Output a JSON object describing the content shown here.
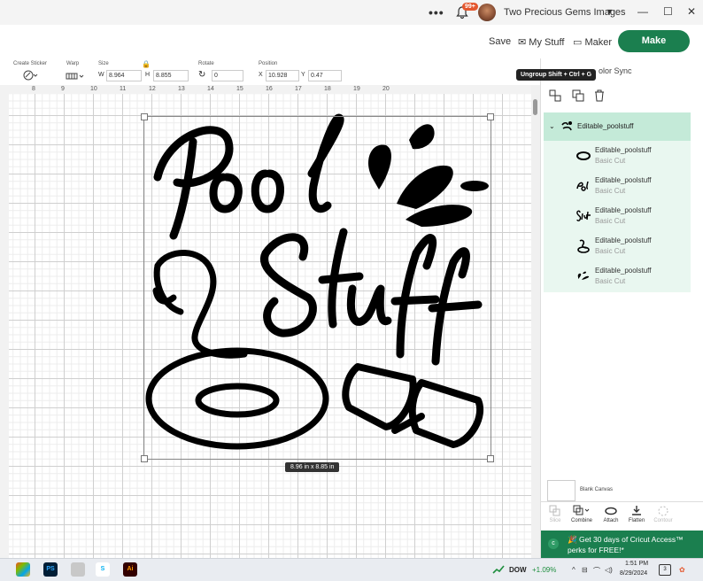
{
  "titlebar": {
    "more_label": "•••",
    "notification_badge": "99+",
    "account_name": "Two Precious Gems Images"
  },
  "header": {
    "save_label": "Save",
    "my_stuff_label": "My Stuff",
    "machine_label": "Maker",
    "make_button_label": "Make"
  },
  "toolbar": {
    "create_sticker_label": "Create Sticker",
    "warp_label": "Warp",
    "size_label": "Size",
    "width_prefix": "W",
    "width_value": "8.964",
    "height_prefix": "H",
    "height_value": "8.855",
    "rotate_label": "Rotate",
    "rotate_value": "0",
    "position_label": "Position",
    "x_prefix": "X",
    "x_value": "10.928",
    "y_prefix": "Y",
    "y_value": "0.47"
  },
  "ruler": {
    "ticks": [
      "8",
      "9",
      "10",
      "11",
      "12",
      "13",
      "14",
      "15",
      "16",
      "17",
      "18",
      "19",
      "20"
    ]
  },
  "canvas": {
    "size_label": "8.96  in x 8.85  in"
  },
  "tooltip": {
    "text": "Ungroup Shift + Ctrl + G"
  },
  "panel": {
    "color_sync_label": "olor Sync",
    "group_name": "Editable_poolstuff",
    "layers": [
      {
        "name": "Editable_poolstuff",
        "type": "Basic Cut",
        "icon": "float-ring-icon"
      },
      {
        "name": "Editable_poolstuff",
        "type": "Basic Cut",
        "icon": "pool-text-icon"
      },
      {
        "name": "Editable_poolstuff",
        "type": "Basic Cut",
        "icon": "stuff-text-icon"
      },
      {
        "name": "Editable_poolstuff",
        "type": "Basic Cut",
        "icon": "flamingo-icon"
      },
      {
        "name": "Editable_poolstuff",
        "type": "Basic Cut",
        "icon": "splash-icon"
      }
    ],
    "blank_canvas_label": "Blank Canvas",
    "tools": {
      "slice": "Slice",
      "combine": "Combine",
      "attach": "Attach",
      "flatten": "Flatten",
      "contour": "Contour"
    },
    "promo_line1": "Get 30 days of Cricut Access™",
    "promo_line2": "perks for FREE!*"
  },
  "taskbar": {
    "stock_name": "DOW",
    "stock_change": "+1.09%",
    "time": "1:51 PM",
    "date": "8/29/2024",
    "notif_count": "3",
    "apps": [
      "PS",
      "Ai"
    ]
  },
  "colors": {
    "brand_green": "#1b7f4f",
    "layer_group_bg": "#c4ead8",
    "layer_bg": "#e9f7f0",
    "stock_up": "#1e8e3e"
  }
}
